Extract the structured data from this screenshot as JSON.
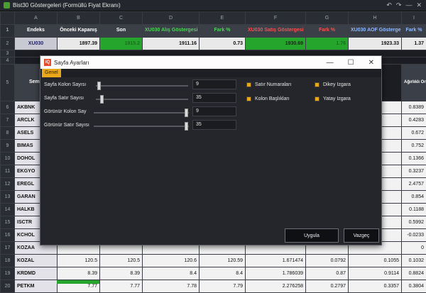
{
  "window": {
    "title": "Bist30 Göstergeleri (Formüllü Fiyat Ekranı)"
  },
  "columns": [
    "A",
    "B",
    "C",
    "D",
    "E",
    "F",
    "G",
    "H",
    "I"
  ],
  "headers": [
    "Endeks",
    "Önceki Kapanış",
    "Son",
    "XU030 Alış Göstergesi",
    "Fark %",
    "XU030 Satış Göstergesi",
    "Fark %",
    "XU030 AOF Göstergesi",
    "Fark %"
  ],
  "row2": {
    "name": "XU030",
    "prev": "1897.39",
    "last": "1915.2",
    "buy": "1911.16",
    "buy_diff": "0.73",
    "sell": "1930.69",
    "sell_diff": "1.76",
    "aof": "1923.33",
    "aof_diff": "1.37"
  },
  "row5_left": "Semb",
  "row5_right": "Ağırlıklı Ortalama Fiyatlarına Bağlı Endekse Etki Puanı",
  "rows": [
    {
      "n": "6",
      "sym": "AKBNK",
      "i": "0.8389"
    },
    {
      "n": "7",
      "sym": "ARCLK",
      "i": "0.4283"
    },
    {
      "n": "8",
      "sym": "ASELS",
      "i": "0.672"
    },
    {
      "n": "9",
      "sym": "BIMAS",
      "i": "0.752"
    },
    {
      "n": "10",
      "sym": "DOHOL",
      "i": "0.1366"
    },
    {
      "n": "11",
      "sym": "EKGYO",
      "i": "0.3237"
    },
    {
      "n": "12",
      "sym": "EREGL",
      "i": "2.4757"
    },
    {
      "n": "13",
      "sym": "GARAN",
      "i": "0.854"
    },
    {
      "n": "14",
      "sym": "HALKB",
      "i": "0.1188"
    },
    {
      "n": "15",
      "sym": "ISCTR",
      "i": "0.5992"
    },
    {
      "n": "16",
      "sym": "KCHOL",
      "i": "-0.0233"
    },
    {
      "n": "17",
      "sym": "KOZAA",
      "i": "0"
    }
  ],
  "bottom_rows": [
    {
      "n": "18",
      "sym": "KOZAL",
      "b": "120.5",
      "c": "120.5",
      "d": "120.6",
      "e": "120.59",
      "f": "1.671474",
      "g": "0.0792",
      "h": "0.1055",
      "i": "0.1032"
    },
    {
      "n": "19",
      "sym": "KRDMD",
      "b": "8.39",
      "c": "8.39",
      "d": "8.4",
      "e": "8.4",
      "f": "1.786039",
      "g": "0.87",
      "h": "0.9114",
      "i": "0.8824"
    },
    {
      "n": "20",
      "sym": "PETKM",
      "b": "7.77",
      "c": "7.77",
      "d": "7.78",
      "e": "7.79",
      "f": "2.276258",
      "g": "0.2797",
      "h": "0.3357",
      "i": "0.3804"
    }
  ],
  "dialog": {
    "title": "Sayfa Ayarları",
    "icon_text": "iQ",
    "tab": "Genel",
    "fields": [
      {
        "label": "Sayfa Kolon Sayısı",
        "value": "9",
        "level": 0.02
      },
      {
        "label": "Sayfa Satır Sayısı",
        "value": "35",
        "level": 0.05
      },
      {
        "label": "Görünür Kolon Say",
        "value": "9",
        "level": 1.0
      },
      {
        "label": "Görünür Satır Sayısı",
        "value": "35",
        "level": 1.0
      }
    ],
    "checkboxes": [
      {
        "label": "Satır Numaraları",
        "checked": true
      },
      {
        "label": "Dikey Izgara",
        "checked": true
      },
      {
        "label": "Kolon Başlıkları",
        "checked": true
      },
      {
        "label": "Yatay Izgara",
        "checked": true
      }
    ],
    "ok": "Uygula",
    "cancel": "Vazgeç"
  },
  "colors": {
    "accent": "#e8a81a",
    "green": "#4fd35a",
    "red": "#ff4d4d",
    "annotation": "#1616d0"
  }
}
